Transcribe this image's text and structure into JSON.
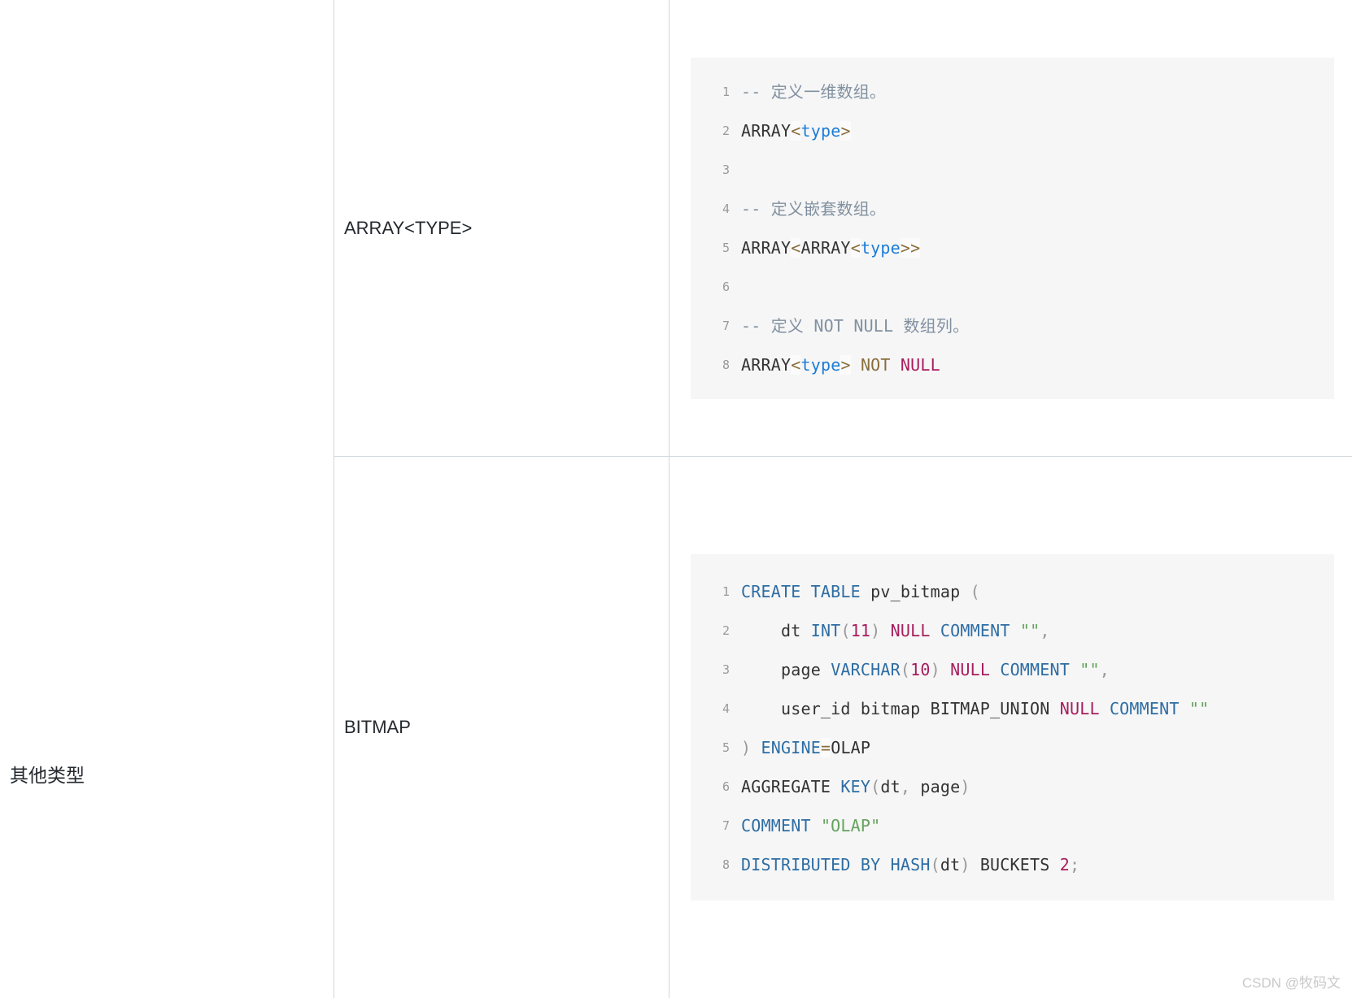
{
  "category": {
    "label": "其他类型"
  },
  "rows": [
    {
      "type_name": "ARRAY<TYPE>",
      "code": {
        "lines": [
          {
            "no": "1",
            "tokens": [
              {
                "t": "-- 定义一维数组。",
                "c": "tk-comment-b"
              }
            ]
          },
          {
            "no": "2",
            "tokens": [
              {
                "t": "ARRAY",
                "c": "tk-plain"
              },
              {
                "t": "<",
                "c": "tk-op"
              },
              {
                "t": "type",
                "c": "tk-blue"
              },
              {
                "t": ">",
                "c": "tk-op"
              }
            ]
          },
          {
            "no": "3",
            "tokens": [
              {
                "t": "",
                "c": "tk-plain"
              }
            ]
          },
          {
            "no": "4",
            "tokens": [
              {
                "t": "-- 定义嵌套数组。",
                "c": "tk-comment-b"
              }
            ]
          },
          {
            "no": "5",
            "tokens": [
              {
                "t": "ARRAY",
                "c": "tk-plain"
              },
              {
                "t": "<",
                "c": "tk-op"
              },
              {
                "t": "ARRAY",
                "c": "tk-plain"
              },
              {
                "t": "<",
                "c": "tk-op"
              },
              {
                "t": "type",
                "c": "tk-blue"
              },
              {
                "t": ">>",
                "c": "tk-op"
              }
            ]
          },
          {
            "no": "6",
            "tokens": [
              {
                "t": "",
                "c": "tk-plain"
              }
            ]
          },
          {
            "no": "7",
            "tokens": [
              {
                "t": "-- 定义 NOT NULL 数组列。",
                "c": "tk-comment-b"
              }
            ]
          },
          {
            "no": "8",
            "tokens": [
              {
                "t": "ARRAY",
                "c": "tk-plain"
              },
              {
                "t": "<",
                "c": "tk-op"
              },
              {
                "t": "type",
                "c": "tk-blue"
              },
              {
                "t": ">",
                "c": "tk-op"
              },
              {
                "t": " ",
                "c": "tk-plain"
              },
              {
                "t": "NOT",
                "c": "tk-not"
              },
              {
                "t": " ",
                "c": "tk-plain"
              },
              {
                "t": "NULL",
                "c": "tk-null"
              }
            ]
          }
        ]
      }
    },
    {
      "type_name": "BITMAP",
      "code": {
        "lines": [
          {
            "no": "1",
            "tokens": [
              {
                "t": "CREATE TABLE",
                "c": "tk-kw"
              },
              {
                "t": " pv_bitmap ",
                "c": "tk-plain"
              },
              {
                "t": "(",
                "c": "tk-punc"
              }
            ]
          },
          {
            "no": "2",
            "tokens": [
              {
                "t": "    dt ",
                "c": "tk-plain"
              },
              {
                "t": "INT",
                "c": "tk-type"
              },
              {
                "t": "(",
                "c": "tk-punc"
              },
              {
                "t": "11",
                "c": "tk-num"
              },
              {
                "t": ")",
                "c": "tk-punc"
              },
              {
                "t": " ",
                "c": "tk-plain"
              },
              {
                "t": "NULL",
                "c": "tk-null"
              },
              {
                "t": " ",
                "c": "tk-plain"
              },
              {
                "t": "COMMENT",
                "c": "tk-kw"
              },
              {
                "t": " ",
                "c": "tk-plain"
              },
              {
                "t": "\"\"",
                "c": "tk-str"
              },
              {
                "t": ",",
                "c": "tk-punc"
              }
            ]
          },
          {
            "no": "3",
            "tokens": [
              {
                "t": "    page ",
                "c": "tk-plain"
              },
              {
                "t": "VARCHAR",
                "c": "tk-type"
              },
              {
                "t": "(",
                "c": "tk-punc"
              },
              {
                "t": "10",
                "c": "tk-num"
              },
              {
                "t": ")",
                "c": "tk-punc"
              },
              {
                "t": " ",
                "c": "tk-plain"
              },
              {
                "t": "NULL",
                "c": "tk-null"
              },
              {
                "t": " ",
                "c": "tk-plain"
              },
              {
                "t": "COMMENT",
                "c": "tk-kw"
              },
              {
                "t": " ",
                "c": "tk-plain"
              },
              {
                "t": "\"\"",
                "c": "tk-str"
              },
              {
                "t": ",",
                "c": "tk-punc"
              }
            ]
          },
          {
            "no": "4",
            "tokens": [
              {
                "t": "    user_id bitmap BITMAP_UNION ",
                "c": "tk-plain"
              },
              {
                "t": "NULL",
                "c": "tk-null"
              },
              {
                "t": " ",
                "c": "tk-plain"
              },
              {
                "t": "COMMENT",
                "c": "tk-kw"
              },
              {
                "t": " ",
                "c": "tk-plain"
              },
              {
                "t": "\"\"",
                "c": "tk-str"
              }
            ]
          },
          {
            "no": "5",
            "tokens": [
              {
                "t": ")",
                "c": "tk-punc"
              },
              {
                "t": " ",
                "c": "tk-plain"
              },
              {
                "t": "ENGINE",
                "c": "tk-kw"
              },
              {
                "t": "=",
                "c": "tk-op"
              },
              {
                "t": "OLAP",
                "c": "tk-plain"
              }
            ]
          },
          {
            "no": "6",
            "tokens": [
              {
                "t": "AGGREGATE ",
                "c": "tk-plain"
              },
              {
                "t": "KEY",
                "c": "tk-kw"
              },
              {
                "t": "(",
                "c": "tk-punc"
              },
              {
                "t": "dt",
                "c": "tk-plain"
              },
              {
                "t": ",",
                "c": "tk-punc"
              },
              {
                "t": " page",
                "c": "tk-plain"
              },
              {
                "t": ")",
                "c": "tk-punc"
              }
            ]
          },
          {
            "no": "7",
            "tokens": [
              {
                "t": "COMMENT",
                "c": "tk-kw"
              },
              {
                "t": " ",
                "c": "tk-plain"
              },
              {
                "t": "\"OLAP\"",
                "c": "tk-str"
              }
            ]
          },
          {
            "no": "8",
            "tokens": [
              {
                "t": "DISTRIBUTED BY HASH",
                "c": "tk-kw"
              },
              {
                "t": "(",
                "c": "tk-punc"
              },
              {
                "t": "dt",
                "c": "tk-plain"
              },
              {
                "t": ")",
                "c": "tk-punc"
              },
              {
                "t": " BUCKETS ",
                "c": "tk-plain"
              },
              {
                "t": "2",
                "c": "tk-num"
              },
              {
                "t": ";",
                "c": "tk-punc"
              }
            ]
          }
        ]
      }
    }
  ],
  "watermark": {
    "text": "CSDN @牧码文"
  }
}
